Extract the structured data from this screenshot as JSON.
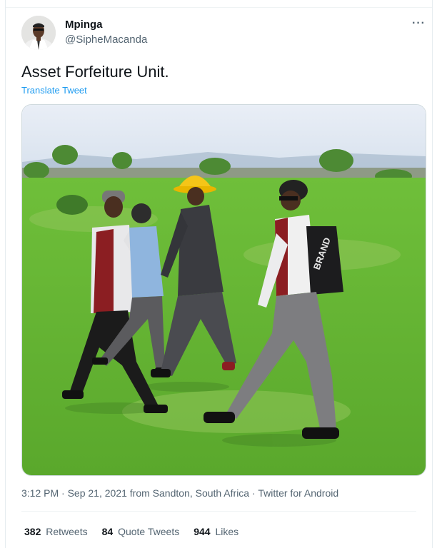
{
  "author": {
    "name": "Mpinga",
    "handle": "@SipheMacanda"
  },
  "tweet": {
    "text": "Asset Forfeiture Unit.",
    "translate_label": "Translate Tweet"
  },
  "meta": {
    "time": "3:12 PM",
    "date": "Sep 21, 2021",
    "location": "from Sandton, South Africa",
    "client": "Twitter for Android",
    "separator": "·"
  },
  "stats": {
    "retweets_count": "382",
    "retweets_label": "Retweets",
    "quotes_count": "84",
    "quotes_label": "Quote Tweets",
    "likes_count": "944",
    "likes_label": "Likes"
  },
  "icons": {
    "more": "more-options-icon"
  },
  "colors": {
    "link": "#1d9bf0",
    "secondary_text": "#536471",
    "primary_text": "#0f1419"
  }
}
